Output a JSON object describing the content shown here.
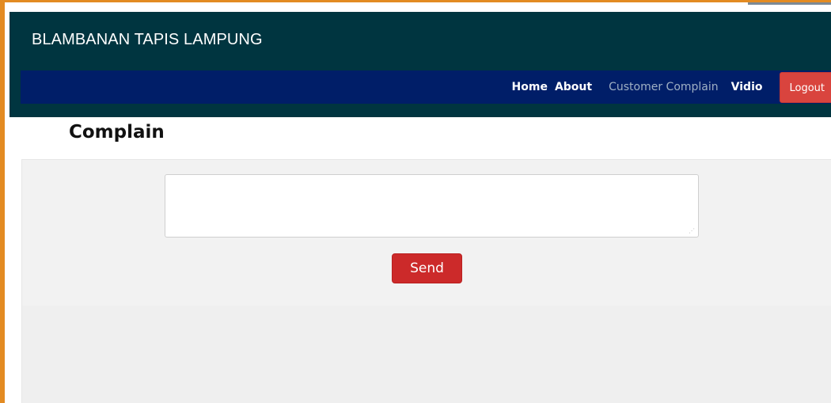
{
  "header": {
    "brand": "BLAMBANAN TAPIS LAMPUNG"
  },
  "nav": {
    "items": [
      {
        "label": "Home",
        "active": false
      },
      {
        "label": "About",
        "active": false
      },
      {
        "label": "Customer Complain",
        "active": true
      },
      {
        "label": "Vidio",
        "active": false
      }
    ],
    "logout_label": "Logout"
  },
  "main": {
    "title": "Complain",
    "complain_field": {
      "value": "",
      "placeholder": ""
    },
    "send_label": "Send"
  },
  "colors": {
    "header_bg": "#003540",
    "navbar_bg": "#001e68",
    "logout_bg": "#d9443e",
    "send_bg": "#cc2a2a",
    "frame_border": "#e38b22",
    "panel_bg": "#f2f2f2"
  }
}
